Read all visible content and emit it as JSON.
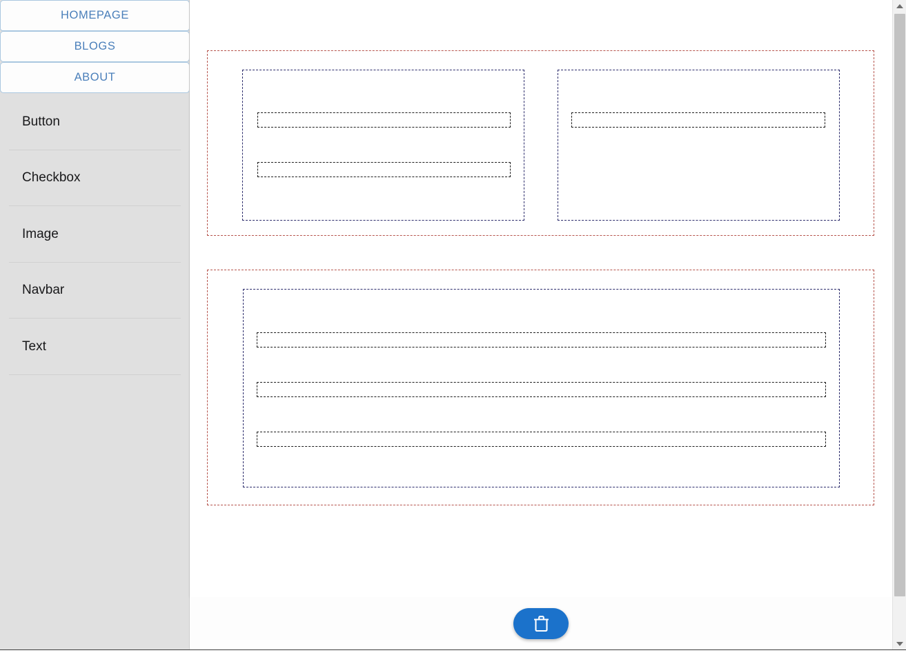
{
  "app": {
    "name": "website-builder-editor",
    "accent_color": "#1b72cb",
    "sidebar_bg": "#e0e0e0",
    "canvas_bg": "#ffffff"
  },
  "sidebar": {
    "pages": [
      {
        "label": "HOMEPAGE",
        "name": "nav-homepage",
        "active": true
      },
      {
        "label": "BLOGS",
        "name": "nav-blogs",
        "active": false
      },
      {
        "label": "ABOUT",
        "name": "nav-about",
        "active": false
      }
    ],
    "components": [
      {
        "label": "Button",
        "name": "component-button"
      },
      {
        "label": "Checkbox",
        "name": "component-checkbox"
      },
      {
        "label": "Image",
        "name": "component-image"
      },
      {
        "label": "Navbar",
        "name": "component-navbar"
      },
      {
        "label": "Text",
        "name": "component-text"
      }
    ]
  },
  "canvas": {
    "rows": [
      {
        "name": "row-1",
        "border_color": "#b5524a",
        "columns": [
          {
            "name": "col-1a",
            "border_color": "#2b2b6b",
            "slots": [
              {
                "name": "slot-1a-1"
              },
              {
                "name": "slot-1a-2"
              }
            ]
          },
          {
            "name": "col-1b",
            "border_color": "#2b2b6b",
            "slots": [
              {
                "name": "slot-1b-1"
              }
            ]
          }
        ]
      },
      {
        "name": "row-2",
        "border_color": "#b5524a",
        "columns": [
          {
            "name": "col-2a",
            "border_color": "#2b2b6b",
            "slots": [
              {
                "name": "slot-2a-1"
              },
              {
                "name": "slot-2a-2"
              },
              {
                "name": "slot-2a-3"
              }
            ]
          }
        ]
      }
    ]
  },
  "toolbar": {
    "delete_icon": "trash-icon",
    "delete_label": ""
  },
  "scrollbar": {
    "up_icon": "chevron-up-icon",
    "down_icon": "chevron-down-icon",
    "orientation": "vertical"
  }
}
